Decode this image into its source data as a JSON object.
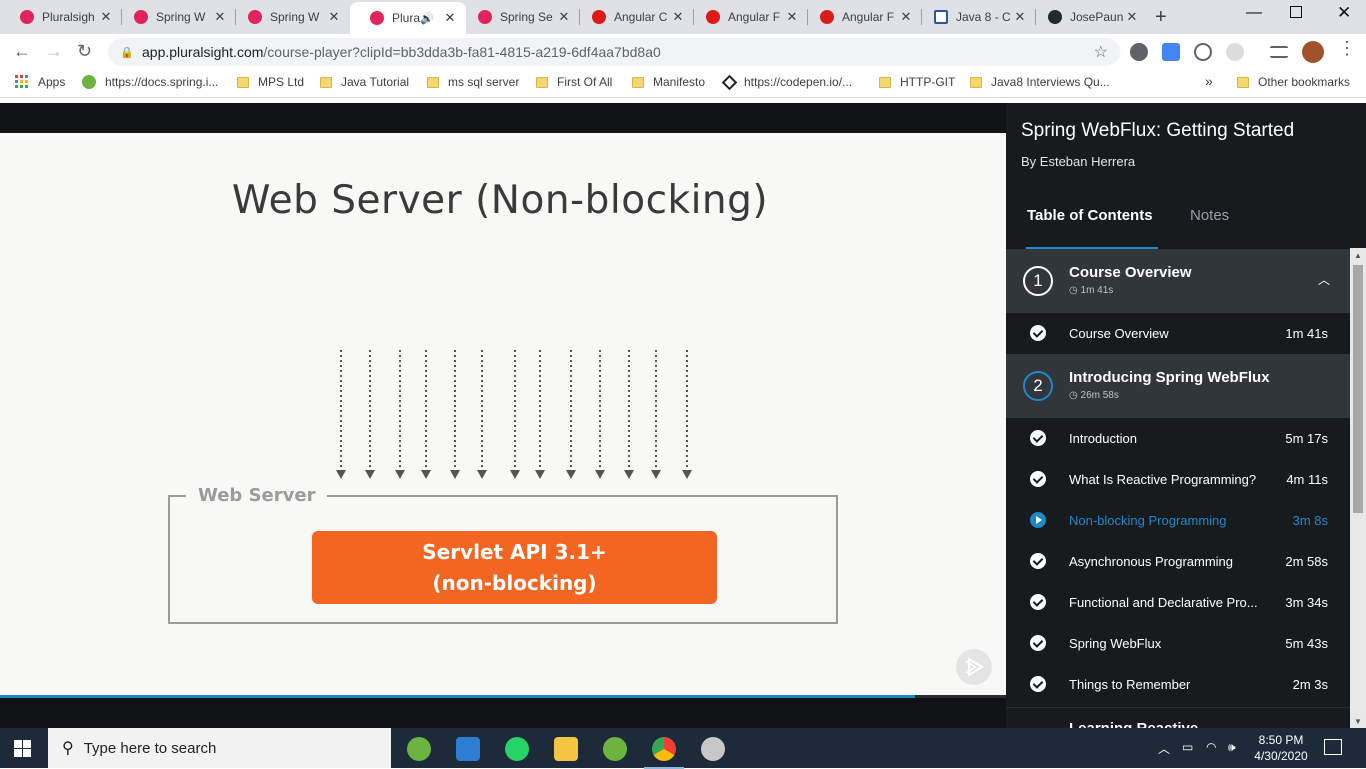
{
  "browser": {
    "tabs": [
      {
        "title": "Pluralsigh",
        "icon": "pluralsight-icon"
      },
      {
        "title": "Spring W",
        "icon": "pluralsight-icon"
      },
      {
        "title": "Spring W",
        "icon": "pluralsight-icon"
      },
      {
        "title": "Plura",
        "icon": "pluralsight-icon",
        "active": true
      },
      {
        "title": "Spring Se",
        "icon": "pluralsight-icon"
      },
      {
        "title": "Angular C",
        "icon": "angular-icon"
      },
      {
        "title": "Angular F",
        "icon": "angular-icon"
      },
      {
        "title": "Angular F",
        "icon": "angular-icon"
      },
      {
        "title": "Java 8 - C",
        "icon": "java-icon"
      },
      {
        "title": "JosePaun",
        "icon": "github-icon"
      }
    ],
    "url_host": "app.pluralsight.com",
    "url_path": "/course-player?clipId=bb3dda3b-fa81-4815-a219-6df4aa7bd8a0",
    "bookmarks": [
      {
        "label": "Apps",
        "icon": "apps-grid-icon"
      },
      {
        "label": "https://docs.spring.i...",
        "icon": "spring-icon"
      },
      {
        "label": "MPS Ltd",
        "icon": "folder-icon"
      },
      {
        "label": "Java Tutorial",
        "icon": "folder-icon"
      },
      {
        "label": "ms sql server",
        "icon": "folder-icon"
      },
      {
        "label": "First Of All",
        "icon": "folder-icon"
      },
      {
        "label": "Manifesto",
        "icon": "folder-icon"
      },
      {
        "label": "https://codepen.io/...",
        "icon": "codepen-icon"
      },
      {
        "label": "HTTP-GIT",
        "icon": "folder-icon"
      },
      {
        "label": "Java8 Interviews Qu...",
        "icon": "folder-icon"
      }
    ],
    "bookmarks_overflow": "»",
    "other_bookmarks": "Other bookmarks"
  },
  "slide": {
    "title": "Web Server (Non-blocking)",
    "box_label": "Web Server",
    "servlet_line1": "Servlet API 3.1+",
    "servlet_line2": "(non-blocking)",
    "arrow_count": 13,
    "progress_fraction": 0.91
  },
  "sidebar": {
    "course_title": "Spring WebFlux: Getting Started",
    "author": "By Esteban Herrera",
    "tab_toc": "Table of Contents",
    "tab_notes": "Notes",
    "modules": [
      {
        "number": "1",
        "title": "Course Overview",
        "duration": "1m 41s",
        "clips": [
          {
            "title": "Course Overview",
            "duration": "1m 41s",
            "status": "completed"
          }
        ]
      },
      {
        "number": "2",
        "title": "Introducing Spring WebFlux",
        "duration": "26m 58s",
        "clips": [
          {
            "title": "Introduction",
            "duration": "5m 17s",
            "status": "completed"
          },
          {
            "title": "What Is Reactive Programming?",
            "duration": "4m 11s",
            "status": "completed"
          },
          {
            "title": "Non-blocking Programming",
            "duration": "3m 8s",
            "status": "playing"
          },
          {
            "title": "Asynchronous Programming",
            "duration": "2m 58s",
            "status": "completed"
          },
          {
            "title": "Functional and Declarative Pro...",
            "duration": "3m 34s",
            "status": "completed"
          },
          {
            "title": "Spring WebFlux",
            "duration": "5m 43s",
            "status": "completed"
          },
          {
            "title": "Things to Remember",
            "duration": "2m 3s",
            "status": "completed"
          }
        ]
      },
      {
        "number": "3",
        "title": "Learning Reactive",
        "duration": "",
        "clips": []
      }
    ]
  },
  "taskbar": {
    "search_placeholder": "Type here to search",
    "time": "8:50 PM",
    "date": "4/30/2020"
  },
  "colors": {
    "accent_blue": "#1e88c9",
    "servlet_orange": "#f26622",
    "sidebar_bg": "#181b1e"
  }
}
